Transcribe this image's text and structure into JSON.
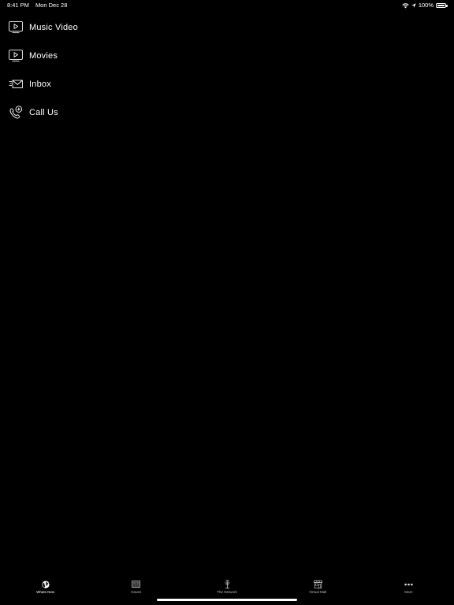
{
  "status_bar": {
    "time": "8:41 PM",
    "date": "Mon Dec 28",
    "battery_percent": "100%",
    "battery_level": 1.0,
    "icons": [
      "wifi-icon",
      "location-arrow-icon",
      "battery-icon"
    ]
  },
  "menu": {
    "items": [
      {
        "label": "Music Video",
        "icon": "tv-play-icon"
      },
      {
        "label": "Movies",
        "icon": "tv-play-icon"
      },
      {
        "label": "Inbox",
        "icon": "envelope-fast-icon"
      },
      {
        "label": "Call Us",
        "icon": "phone-plus-icon"
      }
    ]
  },
  "tab_bar": {
    "tabs": [
      {
        "label": "Whats New",
        "icon": "globe-icon",
        "active": true
      },
      {
        "label": "Issues",
        "icon": "newspaper-icon",
        "active": false
      },
      {
        "label": "The Network",
        "icon": "antenna-icon",
        "active": false
      },
      {
        "label": "Virtual Mall",
        "icon": "storefront-icon",
        "active": false
      },
      {
        "label": "More",
        "icon": "more-dots-icon",
        "active": false
      }
    ]
  },
  "colors": {
    "background": "#000000",
    "text": "#ffffff",
    "tab_label_inactive": "#bbbbbb"
  }
}
